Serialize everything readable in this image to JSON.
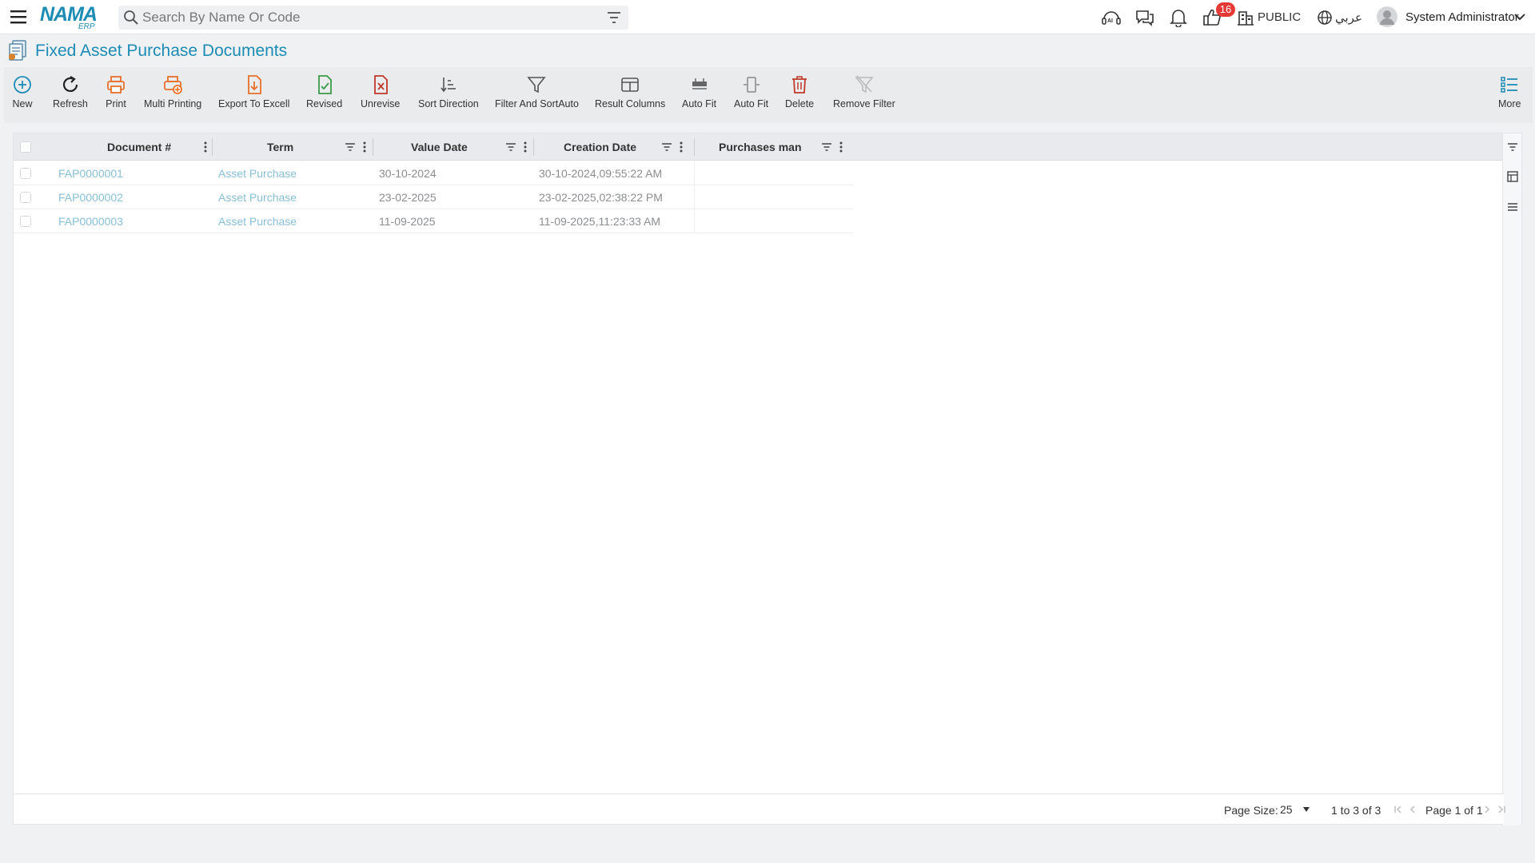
{
  "topbar": {
    "search_placeholder": "Search By Name Or Code",
    "notification_count": "16",
    "branch_label": "PUBLIC",
    "language_label": "عربي",
    "user_name": "System Administrator",
    "logo_main": "NAMA",
    "logo_sub": "ERP"
  },
  "page": {
    "title": "Fixed Asset Purchase Documents"
  },
  "toolbar": {
    "new": "New",
    "refresh": "Refresh",
    "print": "Print",
    "multi_printing": "Multi Printing",
    "export": "Export To Excell",
    "revised": "Revised",
    "unrevise": "Unrevise",
    "sort_direction": "Sort Direction",
    "filter_sort": "Filter And SortAuto",
    "result_columns": "Result Columns",
    "auto_fit_1": "Auto Fit",
    "auto_fit_2": "Auto Fit",
    "delete": "Delete",
    "remove_filter": "Remove Filter",
    "more": "More"
  },
  "grid": {
    "columns": [
      "Document #",
      "Term",
      "Value Date",
      "Creation Date",
      "Purchases man"
    ],
    "rows": [
      {
        "doc": "FAP0000001",
        "term": "Asset Purchase",
        "value_date": "30-10-2024",
        "creation": "30-10-2024,09:55:22 AM",
        "man": ""
      },
      {
        "doc": "FAP0000002",
        "term": "Asset Purchase",
        "value_date": "23-02-2025",
        "creation": "23-02-2025,02:38:22 PM",
        "man": ""
      },
      {
        "doc": "FAP0000003",
        "term": "Asset Purchase",
        "value_date": "11-09-2025",
        "creation": "11-09-2025,11:23:33 AM",
        "man": ""
      }
    ]
  },
  "footer": {
    "page_size_label": "Page Size:",
    "page_size_value": "25",
    "range": "1 to 3 of 3",
    "page_info": "Page 1 of 1"
  },
  "colors": {
    "accent": "#1d8cb5",
    "link": "#87bfd8",
    "badge": "#e53935",
    "orange": "#e8702a",
    "green": "#3a9a4a",
    "red": "#c0392b"
  }
}
